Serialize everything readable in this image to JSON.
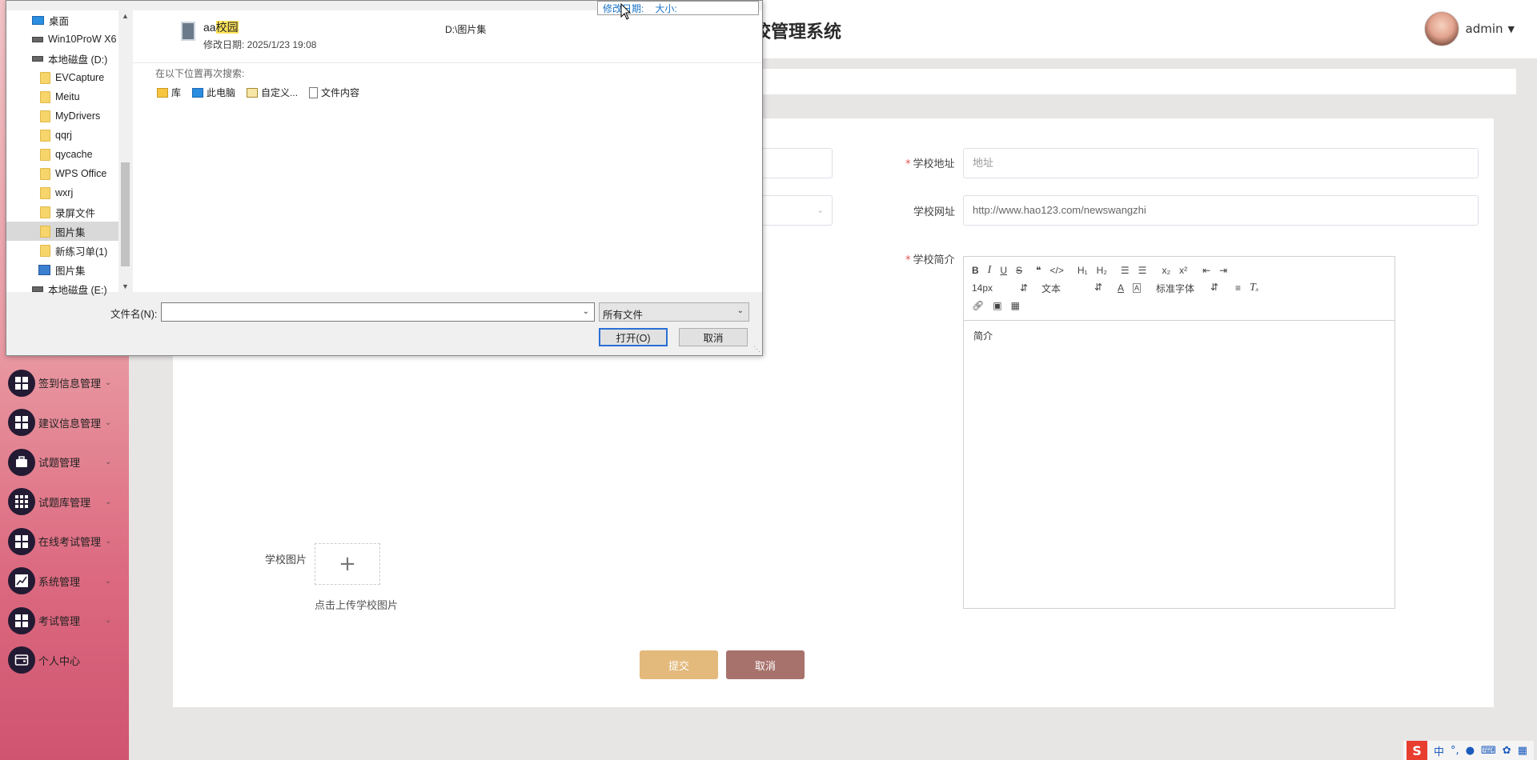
{
  "header": {
    "title": "校管理系统",
    "user_name": "admin"
  },
  "sidebar": {
    "items": [
      {
        "label": "签到信息管理",
        "icon": "grid-icon"
      },
      {
        "label": "建议信息管理",
        "icon": "grid-icon"
      },
      {
        "label": "试题管理",
        "icon": "briefcase-icon"
      },
      {
        "label": "试题库管理",
        "icon": "table-icon"
      },
      {
        "label": "在线考试管理",
        "icon": "grid-icon"
      },
      {
        "label": "系统管理",
        "icon": "chart-icon"
      },
      {
        "label": "考试管理",
        "icon": "grid-icon"
      },
      {
        "label": "个人中心",
        "icon": "wallet-icon"
      }
    ]
  },
  "form": {
    "address_label": "学校地址",
    "address_placeholder": "地址",
    "website_label": "学校网址",
    "website_value": "http://www.hao123.com/newswangzhi",
    "intro_label": "学校简介",
    "image_label": "学校图片",
    "upload_hint": "点击上传学校图片",
    "submit_label": "提交",
    "cancel_label": "取消"
  },
  "editor": {
    "font_size": "14px",
    "text_style": "文本",
    "font_family": "标准字体",
    "content": "简介"
  },
  "dialog": {
    "tooltip_modified": "修改日期:",
    "tooltip_size": "大小:",
    "nav_items": [
      {
        "label": "桌面",
        "kind": "pc"
      },
      {
        "label": "Win10ProW X6",
        "kind": "drive"
      },
      {
        "label": "本地磁盘 (D:)",
        "kind": "drive"
      },
      {
        "label": "EVCapture",
        "kind": "folder"
      },
      {
        "label": "Meitu",
        "kind": "folder"
      },
      {
        "label": "MyDrivers",
        "kind": "folder"
      },
      {
        "label": "qqrj",
        "kind": "folder"
      },
      {
        "label": "qycache",
        "kind": "folder"
      },
      {
        "label": "WPS Office",
        "kind": "folder"
      },
      {
        "label": "wxrj",
        "kind": "folder"
      },
      {
        "label": "录屏文件",
        "kind": "folder"
      },
      {
        "label": "图片集",
        "kind": "folder"
      },
      {
        "label": "新练习单(1)",
        "kind": "folder"
      },
      {
        "label": "图片集",
        "kind": "lib"
      },
      {
        "label": "本地磁盘 (E:)",
        "kind": "drive"
      }
    ],
    "result": {
      "name_prefix": "aa",
      "name_match": "校园",
      "date": "修改日期: 2025/1/23 19:08",
      "path": "D:\\图片集"
    },
    "search_again": "在以下位置再次搜索:",
    "search_links": [
      {
        "label": "库",
        "icon": "library-icon"
      },
      {
        "label": "此电脑",
        "icon": "computer-icon"
      },
      {
        "label": "自定义...",
        "icon": "custom-icon"
      },
      {
        "label": "文件内容",
        "icon": "document-icon"
      }
    ],
    "filename_label": "文件名(N):",
    "filename_value": "",
    "filetype": "所有文件",
    "open_label": "打开(O)",
    "cancel_label": "取消"
  },
  "tray": {
    "logo": "S",
    "lang": "中"
  }
}
